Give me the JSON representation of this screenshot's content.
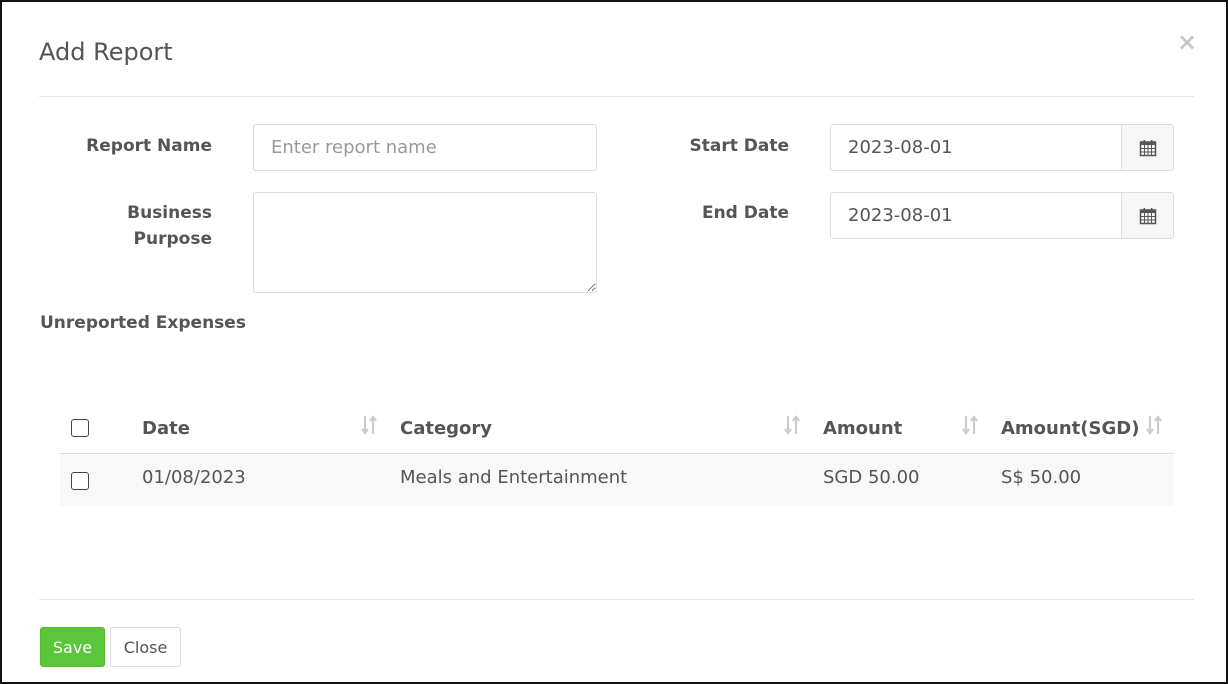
{
  "modal": {
    "title": "Add Report",
    "close_glyph": "×"
  },
  "form": {
    "report_name_label": "Report Name",
    "report_name_placeholder": "Enter report name",
    "report_name_value": "",
    "business_purpose_label_line1": "Business",
    "business_purpose_label_line2": "Purpose",
    "business_purpose_value": "",
    "start_date_label": "Start Date",
    "start_date_value": "2023-08-01",
    "end_date_label": "End Date",
    "end_date_value": "2023-08-01",
    "calendar_icon": "calendar-icon"
  },
  "expenses": {
    "section_title": "Unreported Expenses",
    "columns": [
      "Date",
      "Category",
      "Amount",
      "Amount(SGD)"
    ],
    "sort_icon": "sort-icon",
    "rows": [
      {
        "date": "01/08/2023",
        "category": "Meals and Entertainment",
        "amount": "SGD 50.00",
        "amount_sgd": "S$ 50.00",
        "checked": false
      }
    ]
  },
  "footer": {
    "save_label": "Save",
    "close_label": "Close"
  },
  "colors": {
    "save_button": "#5cc63a",
    "text": "#555555",
    "border": "#dcdcdc"
  }
}
